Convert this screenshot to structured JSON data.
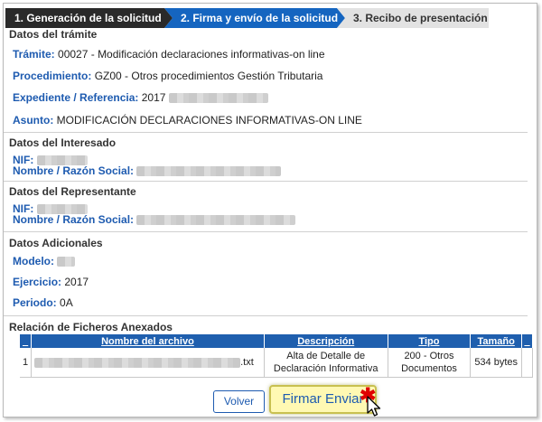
{
  "steps": [
    {
      "label": "1. Generación de la solicitud"
    },
    {
      "label": "2. Firma y envío de la solicitud"
    },
    {
      "label": "3. Recibo de presentación"
    }
  ],
  "tramite_section": {
    "title": "Datos del trámite",
    "tramite_label": "Trámite:",
    "tramite_value": "00027 - Modificación declaraciones informativas-on line",
    "procedimiento_label": "Procedimiento:",
    "procedimiento_value": "GZ00 - Otros procedimientos Gestión Tributaria",
    "expediente_label": "Expediente / Referencia:",
    "expediente_value": "2017",
    "asunto_label": "Asunto:",
    "asunto_value": "MODIFICACIÓN DECLARACIONES INFORMATIVAS-ON LINE"
  },
  "interesado_section": {
    "title": "Datos del Interesado",
    "nif_label": "NIF:",
    "nombre_label": "Nombre / Razón Social:"
  },
  "representante_section": {
    "title": "Datos del Representante",
    "nif_label": "NIF:",
    "nombre_label": "Nombre / Razón Social:"
  },
  "adicionales_section": {
    "title": "Datos Adicionales",
    "modelo_label": "Modelo:",
    "ejercicio_label": "Ejercicio:",
    "ejercicio_value": "2017",
    "periodo_label": "Periodo:",
    "periodo_value": "0A"
  },
  "ficheros_section": {
    "title": "Relación de Ficheros Anexados",
    "columns": [
      "_",
      "Nombre del archivo",
      "Descripción",
      "Tipo",
      "Tamaño",
      "_"
    ],
    "rows": [
      {
        "index": "1",
        "filename_suffix": ".txt",
        "descripcion_l1": "Alta de Detalle de",
        "descripcion_l2": "Declaración Informativa",
        "tipo_l1": "200 - Otros",
        "tipo_l2": "Documentos",
        "tamano": "534 bytes"
      }
    ]
  },
  "buttons": {
    "volver": "Volver",
    "firmar": "Firmar Enviar"
  }
}
